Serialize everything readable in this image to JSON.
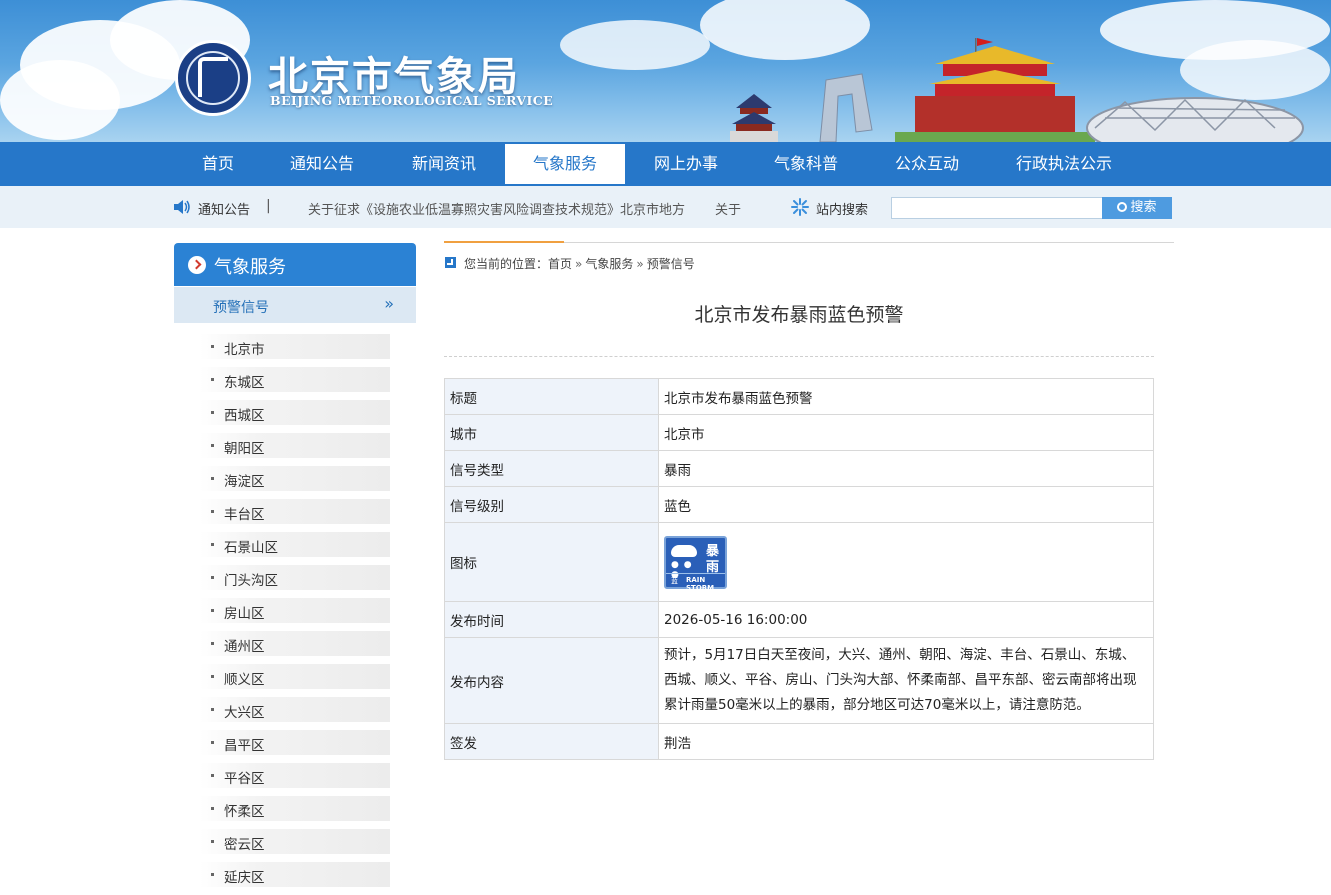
{
  "header": {
    "title": "北京市气象局",
    "subtitle": "BEIJING METEOROLOGICAL SERVICE"
  },
  "nav": {
    "items": [
      "首页",
      "通知公告",
      "新闻资讯",
      "气象服务",
      "网上办事",
      "气象科普",
      "公众互动",
      "行政执法公示"
    ],
    "active": "气象服务"
  },
  "noticebar": {
    "label": "通知公告",
    "separator": "|",
    "ticker": [
      "关于征求《设施农业低温寡照灾害风险调查技术规范》北京市地方",
      "关于"
    ],
    "search_label": "站内搜索",
    "search_value": "",
    "search_button": "搜索"
  },
  "sidebar": {
    "title": "气象服务",
    "sub_item": "预警信号",
    "sub_arrow": "»",
    "districts": [
      "北京市",
      "东城区",
      "西城区",
      "朝阳区",
      "海淀区",
      "丰台区",
      "石景山区",
      "门头沟区",
      "房山区",
      "通州区",
      "顺义区",
      "大兴区",
      "昌平区",
      "平谷区",
      "怀柔区",
      "密云区",
      "延庆区"
    ]
  },
  "breadcrumb": {
    "prefix": "您当前的位置：",
    "items": [
      "首页",
      "气象服务",
      "预警信号"
    ],
    "separator": "»"
  },
  "article": {
    "title": "北京市发布暴雨蓝色预警",
    "rows": {
      "title_key": "标题",
      "title_val": "北京市发布暴雨蓝色预警",
      "city_key": "城市",
      "city_val": "北京市",
      "type_key": "信号类型",
      "type_val": "暴雨",
      "level_key": "信号级别",
      "level_val": "蓝色",
      "icon_key": "图标",
      "time_key": "发布时间",
      "time_val": "2026-05-16 16:00:00",
      "content_key": "发布内容",
      "content_val": "预计，5月17日白天至夜间，大兴、通州、朝阳、海淀、丰台、石景山、东城、西城、顺义、平谷、房山、门头沟大部、怀柔南部、昌平东部、密云南部将出现累计雨量50毫米以上的暴雨，部分地区可达70毫米以上，请注意防范。",
      "signer_key": "签发",
      "signer_val": "荆浩"
    },
    "icon": {
      "chars": [
        "暴",
        "雨"
      ],
      "eng": "RAIN STORM",
      "cn_small": "蓝"
    }
  },
  "colors": {
    "nav_bg": "#2677c9",
    "sidebar_head": "#2b82d4",
    "notice_bg": "#e9f1f8",
    "table_key_bg": "#eef3fa",
    "warning_blue": "#2a5fb8"
  }
}
